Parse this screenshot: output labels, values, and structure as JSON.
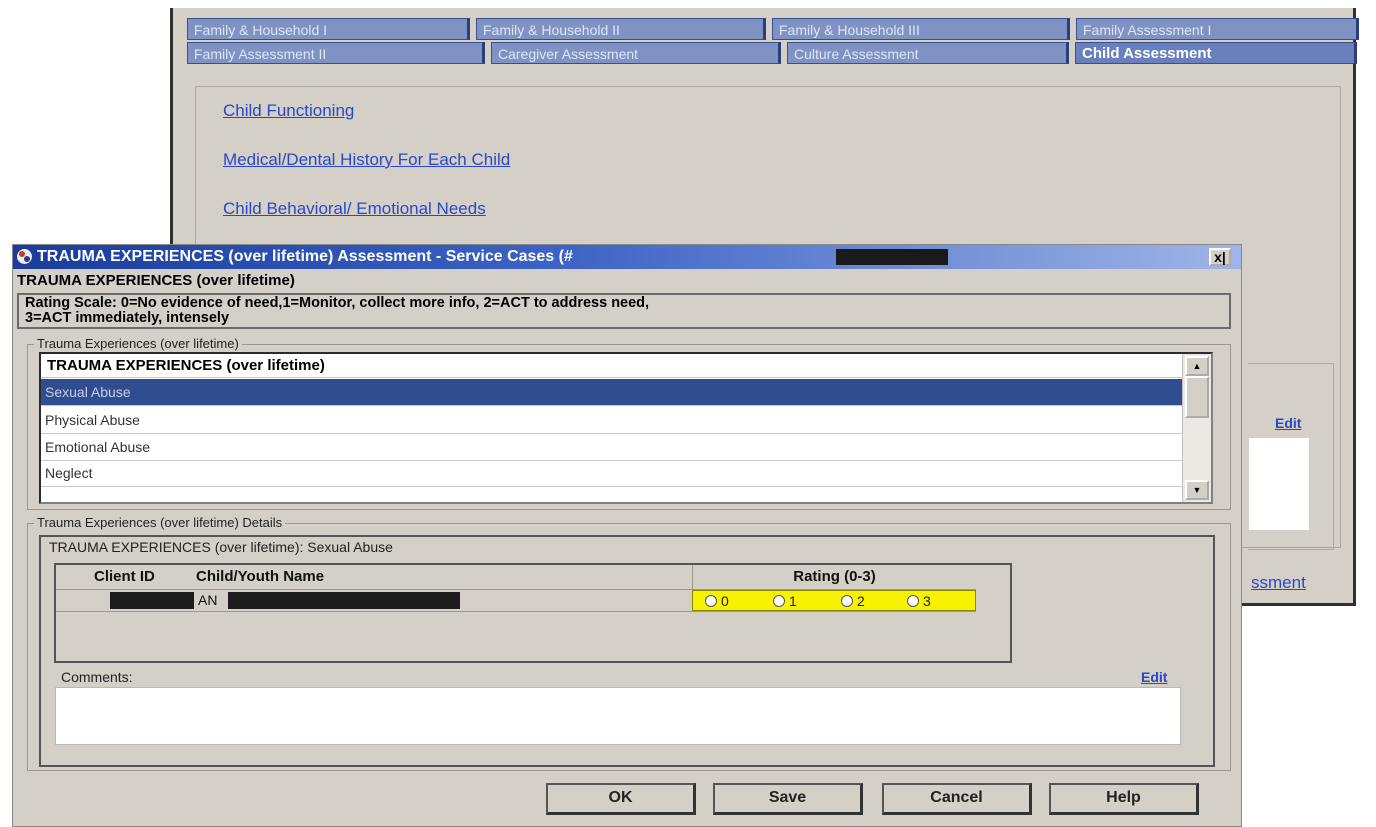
{
  "background_window": {
    "tabs_row1": [
      "Family & Household I",
      "Family & Household II",
      "Family & Household III",
      "Family Assessment I"
    ],
    "tabs_row2": [
      "Family Assessment II",
      "Caregiver Assessment",
      "Culture Assessment",
      "Child Assessment"
    ],
    "active_tab": "Child Assessment",
    "links": [
      "Child Functioning",
      "Medical/Dental History For Each Child",
      "Child Behavioral/ Emotional Needs"
    ],
    "edit_label": "Edit",
    "partial_link": "ssment"
  },
  "dialog": {
    "title": "TRAUMA EXPERIENCES (over lifetime) Assessment - Service Cases (#",
    "close_label": "x|",
    "heading": "TRAUMA EXPERIENCES (over lifetime)",
    "rating_scale_line1": "Rating Scale: 0=No evidence of need,1=Monitor, collect more info, 2=ACT to address need,",
    "rating_scale_line2": "3=ACT immediately, intensely",
    "list_group_label": "Trauma Experiences (over lifetime)",
    "list_header": "TRAUMA EXPERIENCES (over lifetime)",
    "list_items": [
      "Sexual Abuse",
      "Physical Abuse",
      "Emotional Abuse",
      "Neglect"
    ],
    "selected_item": "Sexual Abuse",
    "scroll_up": "▲",
    "scroll_down": "▼",
    "details_group_label": "Trauma Experiences (over lifetime) Details",
    "details_caption": "TRAUMA EXPERIENCES (over lifetime): Sexual Abuse",
    "table": {
      "headers": [
        "Client ID",
        "Child/Youth Name",
        "Rating (0-3)"
      ],
      "row": {
        "client_id": "",
        "name_prefix": "AN"
      },
      "rating_options": [
        "0",
        "1",
        "2",
        "3"
      ]
    },
    "comments_label": "Comments:",
    "comments_edit": "Edit",
    "buttons": {
      "ok": "OK",
      "save": "Save",
      "cancel": "Cancel",
      "help": "Help"
    }
  },
  "colors": {
    "titlebar": "#1a3d9a",
    "selected_row": "#2f4d8f",
    "rating_highlight": "#f6f200",
    "link": "#2a47c9"
  }
}
